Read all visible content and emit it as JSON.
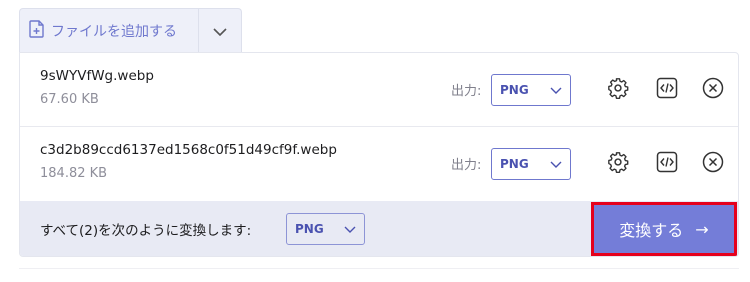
{
  "toolbar": {
    "add_file_label": "ファイルを追加する"
  },
  "files": [
    {
      "name": "9sWYVfWg.webp",
      "size": "67.60 KB",
      "output_label": "出力:",
      "format": "PNG"
    },
    {
      "name": "c3d2b89ccd6137ed1568c0f51d49cf9f.webp",
      "size": "184.82 KB",
      "output_label": "出力:",
      "format": "PNG"
    }
  ],
  "bulk": {
    "label": "すべて(2)を次のように変換します:",
    "format": "PNG"
  },
  "convert": {
    "label": "変換する",
    "arrow": "→"
  },
  "colors": {
    "accent": "#747dd8",
    "highlight_border": "#e5001c",
    "bar_bg": "#e8eaf4"
  },
  "icons": [
    "add-file-icon",
    "chevron-down-icon",
    "gear-icon",
    "code-icon",
    "close-circle-icon",
    "arrow-right-icon"
  ]
}
